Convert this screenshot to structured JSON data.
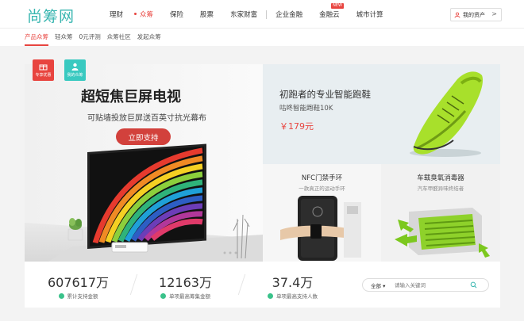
{
  "header": {
    "logo": "尚筹网",
    "nav": [
      {
        "label": "理财",
        "active": false
      },
      {
        "label": "众筹",
        "active": true
      },
      {
        "label": "保险",
        "active": false
      },
      {
        "label": "股票",
        "active": false
      },
      {
        "label": "东家财富",
        "active": false
      },
      {
        "label": "企业金融",
        "active": false
      },
      {
        "label": "金融云",
        "active": false,
        "badge": "NEW"
      },
      {
        "label": "城市计算",
        "active": false
      }
    ],
    "assets_label": "我的资产",
    "assets_chevron": ">"
  },
  "subnav": [
    "产品众筹",
    "轻众筹",
    "0元评测",
    "众筹社区",
    "发起众筹"
  ],
  "banner": {
    "badge_share": "专享优惠",
    "badge_mine": "我的众筹",
    "title": "超短焦巨屏电视",
    "subtitle": "可贴墙投放巨屏送百英寸抗光幕布",
    "button": "立即支持"
  },
  "product_shoe": {
    "title": "初跑者的专业智能跑鞋",
    "subtitle": "咕咚智能跑鞋10K",
    "price": "￥179元"
  },
  "product_nfc": {
    "title": "NFC门禁手环",
    "subtitle": "一款真正的运动手环"
  },
  "product_car": {
    "title": "车载臭氧消毒器",
    "subtitle": "汽车甲醛异味终结者"
  },
  "stats": [
    {
      "value": "607617万",
      "label": "累计支持金额"
    },
    {
      "value": "12163万",
      "label": "单项最高筹集金额"
    },
    {
      "value": "37.4万",
      "label": "单项最高支持人数"
    }
  ],
  "search": {
    "scope": "全部",
    "placeholder": "请输入关键词"
  },
  "colors": {
    "brand": "#39b6b0",
    "accent": "#e8443f",
    "button": "#d2413c"
  }
}
